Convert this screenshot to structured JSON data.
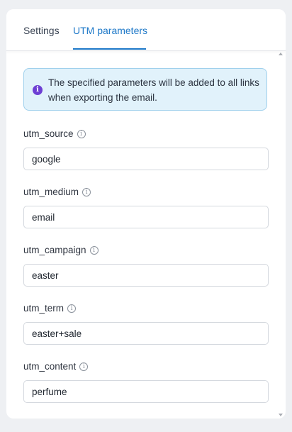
{
  "tabs": {
    "settings_label": "Settings",
    "utm_label": "UTM parameters",
    "active": "UTM parameters"
  },
  "info": {
    "icon": "info-icon",
    "text": "The specified parameters will be added to all links when exporting the email."
  },
  "fields": [
    {
      "label": "utm_source",
      "value": "google"
    },
    {
      "label": "utm_medium",
      "value": "email"
    },
    {
      "label": "utm_campaign",
      "value": "easter"
    },
    {
      "label": "utm_term",
      "value": "easter+sale"
    },
    {
      "label": "utm_content",
      "value": "perfume"
    }
  ],
  "colors": {
    "accent": "#1d78c8",
    "info_bg": "#e1f2fb",
    "info_border": "#9fd0ec",
    "info_icon": "#6d3fd4"
  }
}
